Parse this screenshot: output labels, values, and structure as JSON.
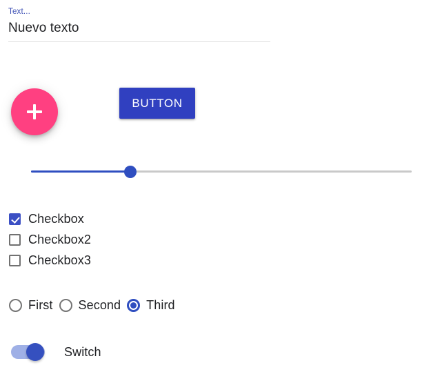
{
  "colors": {
    "accent_blue": "#3f51b5",
    "button_blue": "#3040c0",
    "slider_blue": "#2f4ec0",
    "fab_pink": "#ff4081",
    "checkbox_blue": "#3b4fc4",
    "switch_track": "#9fb0e6",
    "switch_thumb": "#3550bf",
    "unchecked_gray": "#717171",
    "underline_gray": "#e0e0e0",
    "text": "#202124",
    "background": "#ffffff"
  },
  "text_field": {
    "label": "Text...",
    "value": "Nuevo texto",
    "placeholder": "Text..."
  },
  "fab": {
    "icon": "plus-icon",
    "aria_label": "Add"
  },
  "button": {
    "label": "BUTTON"
  },
  "slider": {
    "value": 26,
    "min": 0,
    "max": 100,
    "fill_percent": 26
  },
  "checkboxes": [
    {
      "label": "Checkbox",
      "checked": true
    },
    {
      "label": "Checkbox2",
      "checked": false
    },
    {
      "label": "Checkbox3",
      "checked": false
    }
  ],
  "radios": [
    {
      "label": "First",
      "selected": false
    },
    {
      "label": "Second",
      "selected": false
    },
    {
      "label": "Third",
      "selected": true
    }
  ],
  "switch": {
    "label": "Switch",
    "on": true
  }
}
